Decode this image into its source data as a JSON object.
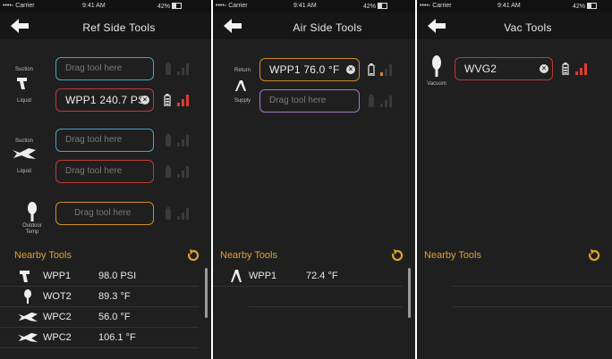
{
  "status": {
    "carrier": "••••◦ Carrier",
    "time": "9:41 AM",
    "battery_left": "42%",
    "battery_right": "42%"
  },
  "colors": {
    "background": "#1f1f20",
    "accent": "#e0a030",
    "blue": "#4aa3c2",
    "red": "#c03a35",
    "orange": "#d08a2a",
    "purple": "#a57bc4"
  },
  "ref": {
    "title": "Ref Side Tools",
    "suction_label": "Suction",
    "liquid_label": "Liquid",
    "outdoor_label": "Outdoor Temp",
    "suction1_placeholder": "Drag tool here",
    "liquid1_value": "WPP1  240.7 PSI",
    "suction2_placeholder": "Drag tool here",
    "liquid2_placeholder": "Drag tool here",
    "outdoor_placeholder": "Drag tool here",
    "nearby_title": "Nearby Tools",
    "nearby": [
      {
        "icon": "pressure-probe-icon",
        "name": "WPP1",
        "value": "98.0 PSI"
      },
      {
        "icon": "temp-probe-icon",
        "name": "WOT2",
        "value": "89.3 °F"
      },
      {
        "icon": "pipe-clamp-icon",
        "name": "WPC2",
        "value": "56.0 °F"
      },
      {
        "icon": "pipe-clamp-icon",
        "name": "WPC2",
        "value": "106.1 °F"
      }
    ]
  },
  "air": {
    "title": "Air Side Tools",
    "return_label": "Return",
    "supply_label": "Supply",
    "return_value": "WPP1  76.0 °F",
    "supply_placeholder": "Drag tool here",
    "nearby_title": "Nearby Tools",
    "nearby": [
      {
        "icon": "air-probe-icon",
        "name": "WPP1",
        "value": "72.4 °F"
      }
    ]
  },
  "vac": {
    "title": "Vac Tools",
    "vacuum_label": "Vacuum",
    "vacuum_value": "WVG2",
    "nearby_title": "Nearby Tools"
  }
}
